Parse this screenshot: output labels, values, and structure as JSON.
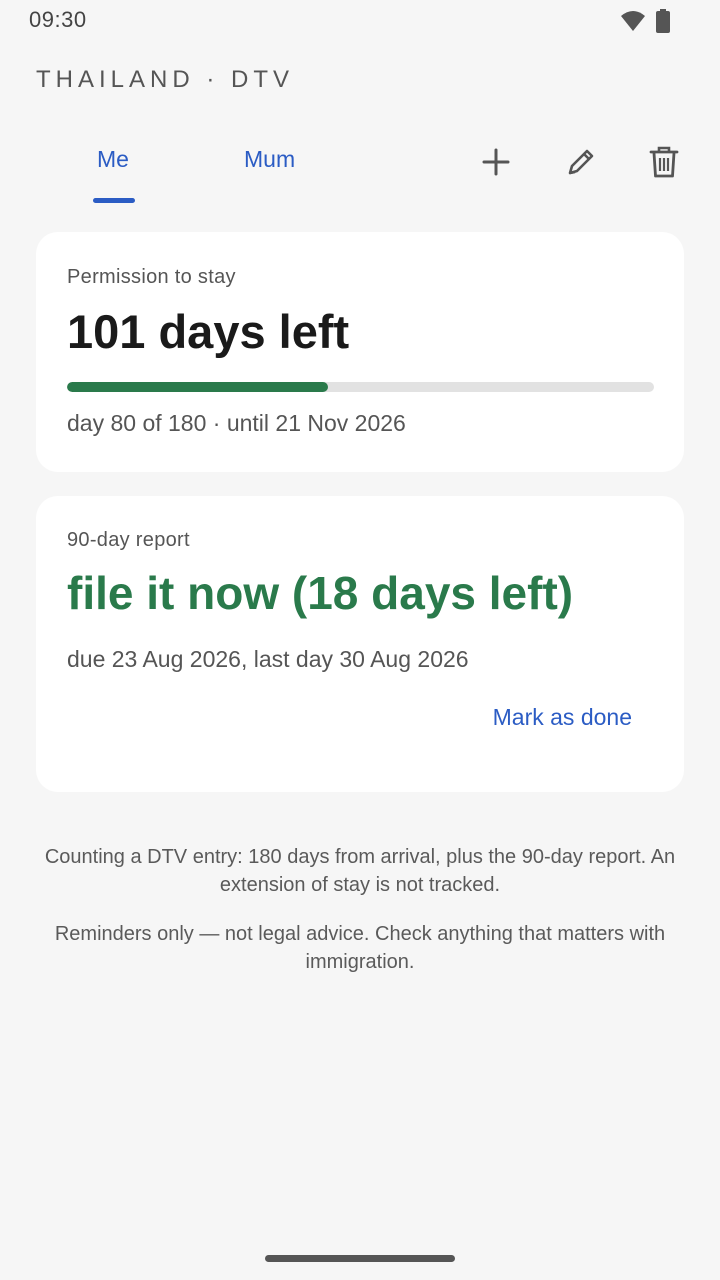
{
  "status_bar": {
    "time": "09:30",
    "icons": [
      "wifi-icon",
      "battery-icon"
    ]
  },
  "app": {
    "title": "THAILAND · DTV"
  },
  "tabs": {
    "items": [
      {
        "label": "Me",
        "selected": true
      },
      {
        "label": "Mum",
        "selected": false
      }
    ],
    "actions": [
      "add-icon",
      "edit-icon",
      "delete-icon"
    ]
  },
  "stay_card": {
    "label": "Permission to stay",
    "headline": "101 days left",
    "progress_fraction": 0.444,
    "detail": "day 80 of 180 · until 21 Nov 2026"
  },
  "report_card": {
    "label": "90-day report",
    "headline": "file it now (18 days left)",
    "detail": "due 23 Aug 2026, last day 30 Aug 2026",
    "action_label": "Mark as done"
  },
  "notes": {
    "counting": "Counting a DTV entry: 180 days from arrival, plus the 90-day report. An extension of stay is not tracked.",
    "disclaimer": "Reminders only — not legal advice. Check anything that matters with immigration."
  },
  "colors": {
    "accent": "#2b5cc4",
    "success": "#2a7a4b",
    "background": "#f6f6f6",
    "card": "#ffffff"
  }
}
